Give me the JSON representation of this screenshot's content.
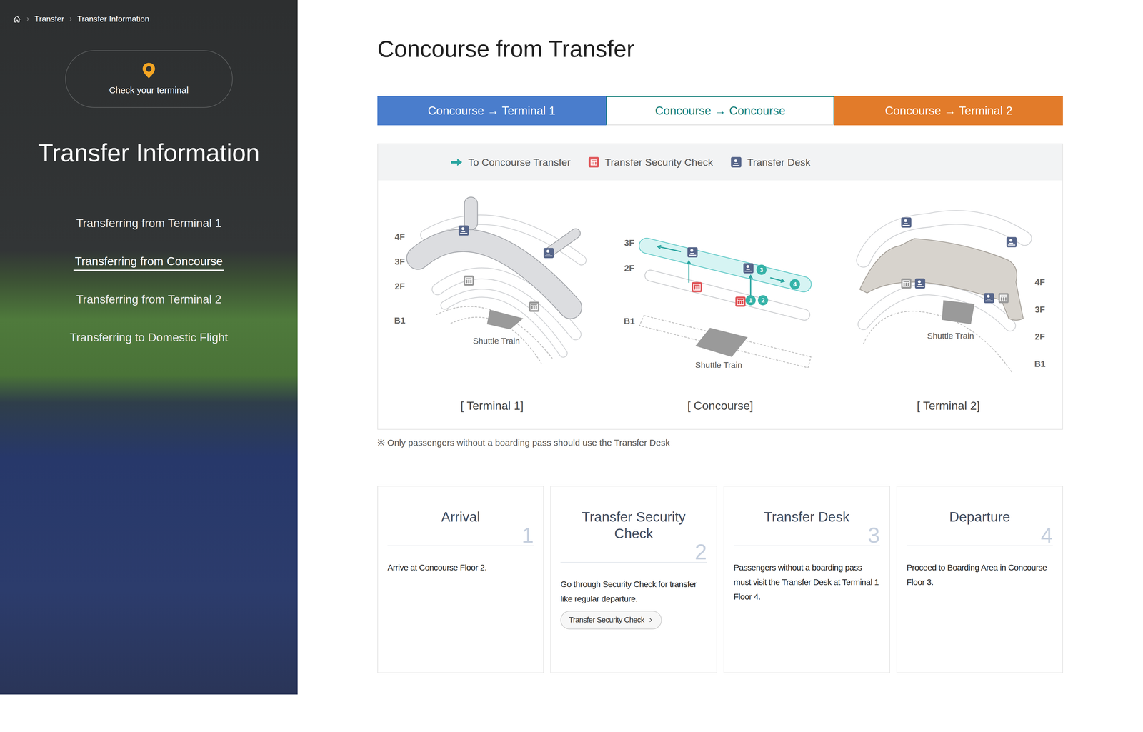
{
  "breadcrumb": [
    "Transfer",
    "Transfer Information"
  ],
  "terminal_button": "Check your terminal",
  "sidebar": {
    "title": "Transfer Information",
    "items": [
      {
        "label": "Transferring from Terminal 1",
        "selected": false
      },
      {
        "label": "Transferring from Concourse",
        "selected": true
      },
      {
        "label": "Transferring from Terminal 2",
        "selected": false
      },
      {
        "label": "Transferring to Domestic Flight",
        "selected": false
      }
    ]
  },
  "page_title": "Concourse from Transfer",
  "tabs": [
    {
      "label": "Concourse → Terminal 1",
      "selected": false,
      "color": "#4a7dcc"
    },
    {
      "label": "Concourse → Concourse",
      "selected": true,
      "color": "#147f7b"
    },
    {
      "label": "Concourse → Terminal 2",
      "selected": false,
      "color": "#e27b2a"
    }
  ],
  "legend": [
    {
      "label": "To Concourse Transfer",
      "kind": "arrow"
    },
    {
      "label": "Transfer Security Check",
      "kind": "security"
    },
    {
      "label": "Transfer Desk",
      "kind": "desk"
    }
  ],
  "maps": [
    {
      "kind": "terminal1",
      "caption": "[ Terminal 1]",
      "floors": [
        "4F",
        "3F",
        "2F",
        "B1"
      ],
      "shuttle": "Shuttle Train"
    },
    {
      "kind": "concourse",
      "caption": "[ Concourse]",
      "floors": [
        "3F",
        "2F",
        "B1"
      ],
      "shuttle": "Shuttle Train",
      "markers": [
        "1",
        "2",
        "3",
        "4"
      ]
    },
    {
      "kind": "terminal2",
      "caption": "[ Terminal 2]",
      "floors": [
        "4F",
        "3F",
        "2F",
        "B1"
      ],
      "shuttle": "Shuttle Train"
    }
  ],
  "note": "※ Only passengers without a boarding pass should use the Transfer Desk",
  "steps": [
    {
      "title": "Arrival",
      "number": "1",
      "text": "Arrive at Concourse Floor 2."
    },
    {
      "title": "Transfer Security Check",
      "number": "2",
      "text": "Go through Security Check for transfer like regular departure.",
      "button": "Transfer Security Check"
    },
    {
      "title": "Transfer Desk",
      "number": "3",
      "text": "Passengers without a boarding pass must visit the Transfer Desk at Terminal 1 Floor 4."
    },
    {
      "title": "Departure",
      "number": "4",
      "text": "Proceed to Boarding Area in Concourse Floor 3."
    }
  ]
}
